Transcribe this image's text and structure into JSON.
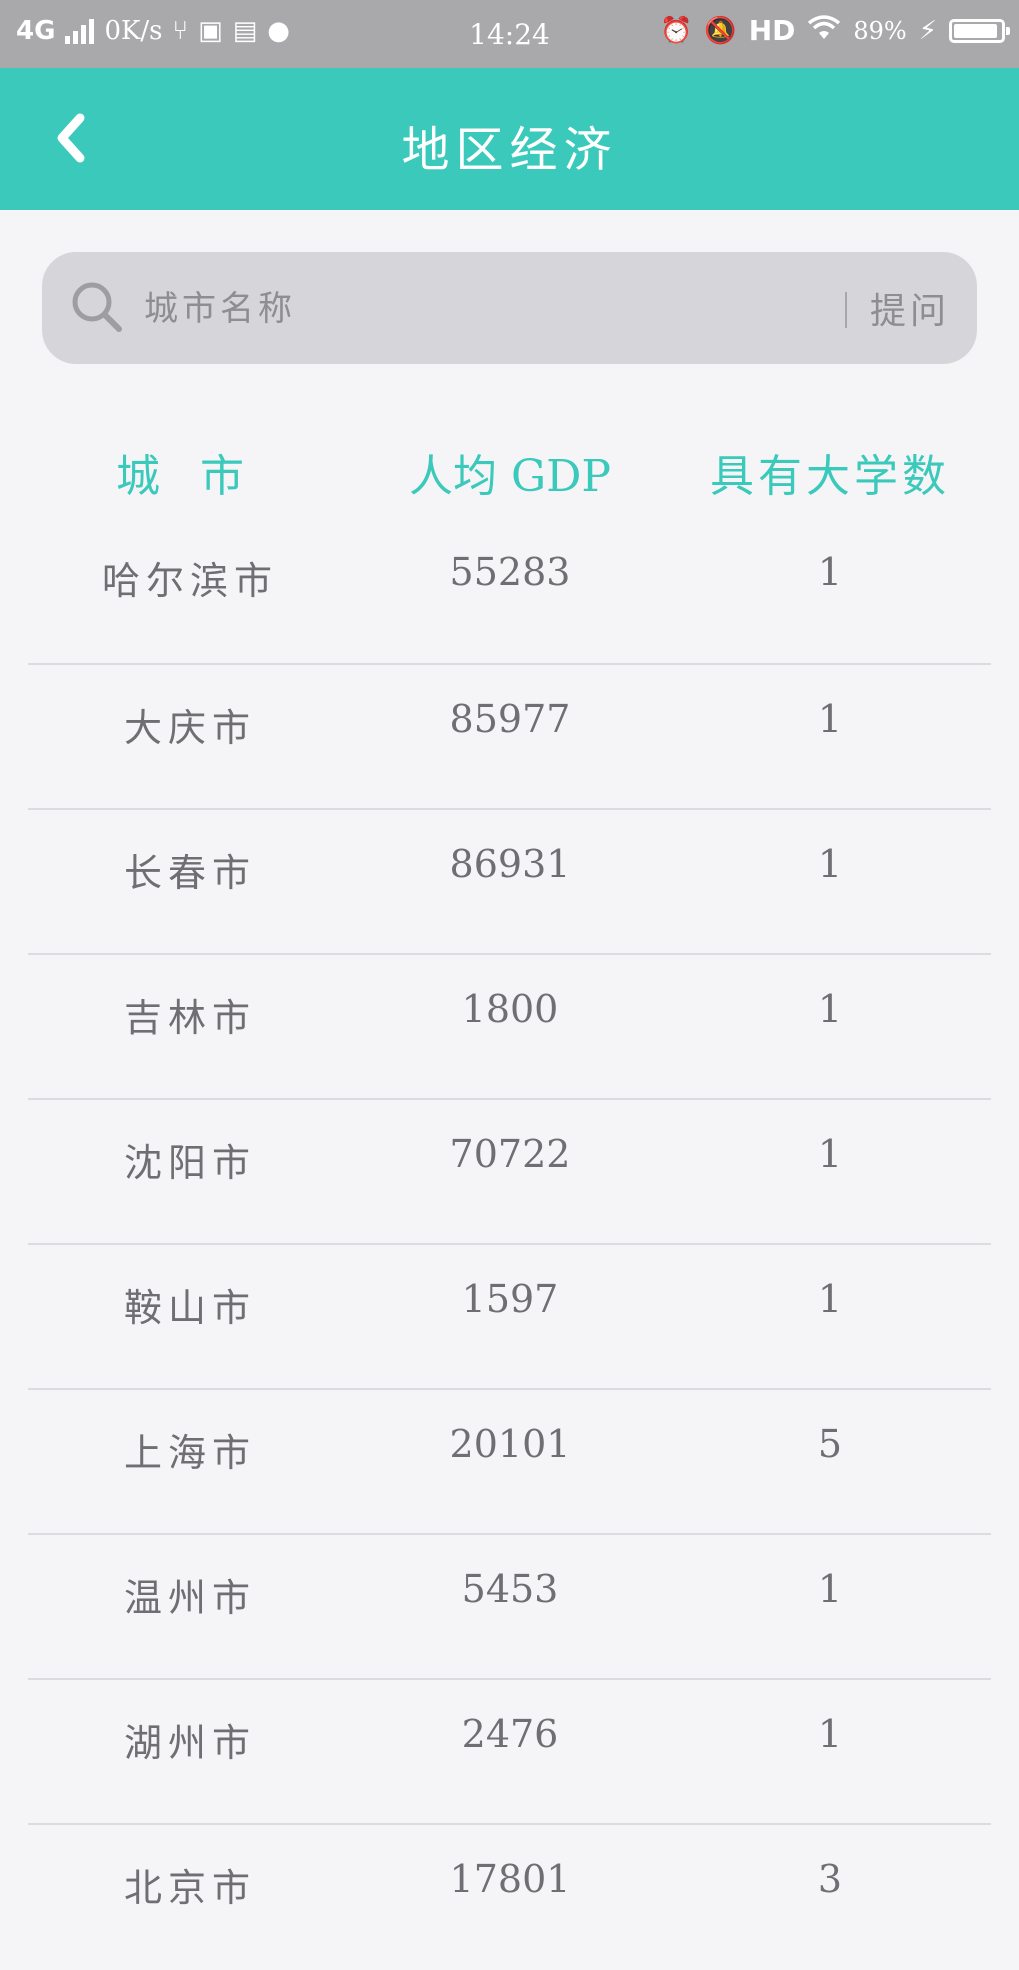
{
  "status_bar": {
    "network": "4G",
    "speed": "0K/s",
    "time": "14:24",
    "hd": "HD",
    "battery_pct": "89%"
  },
  "header": {
    "title": "地区经济",
    "bg_color": "#3ac9bb"
  },
  "search": {
    "placeholder": "城市名称",
    "ask_label": "提问"
  },
  "table": {
    "columns": [
      "城市",
      "人均 GDP",
      "具有大学数"
    ],
    "rows": [
      {
        "city": "哈尔滨市",
        "gdp": "55283",
        "universities": "1"
      },
      {
        "city": "大庆市",
        "gdp": "85977",
        "universities": "1"
      },
      {
        "city": "长春市",
        "gdp": "86931",
        "universities": "1"
      },
      {
        "city": "吉林市",
        "gdp": "1800",
        "universities": "1"
      },
      {
        "city": "沈阳市",
        "gdp": "70722",
        "universities": "1"
      },
      {
        "city": "鞍山市",
        "gdp": "1597",
        "universities": "1"
      },
      {
        "city": "上海市",
        "gdp": "20101",
        "universities": "5"
      },
      {
        "city": "温州市",
        "gdp": "5453",
        "universities": "1"
      },
      {
        "city": "湖州市",
        "gdp": "2476",
        "universities": "1"
      },
      {
        "city": "北京市",
        "gdp": "17801",
        "universities": "3"
      }
    ]
  }
}
